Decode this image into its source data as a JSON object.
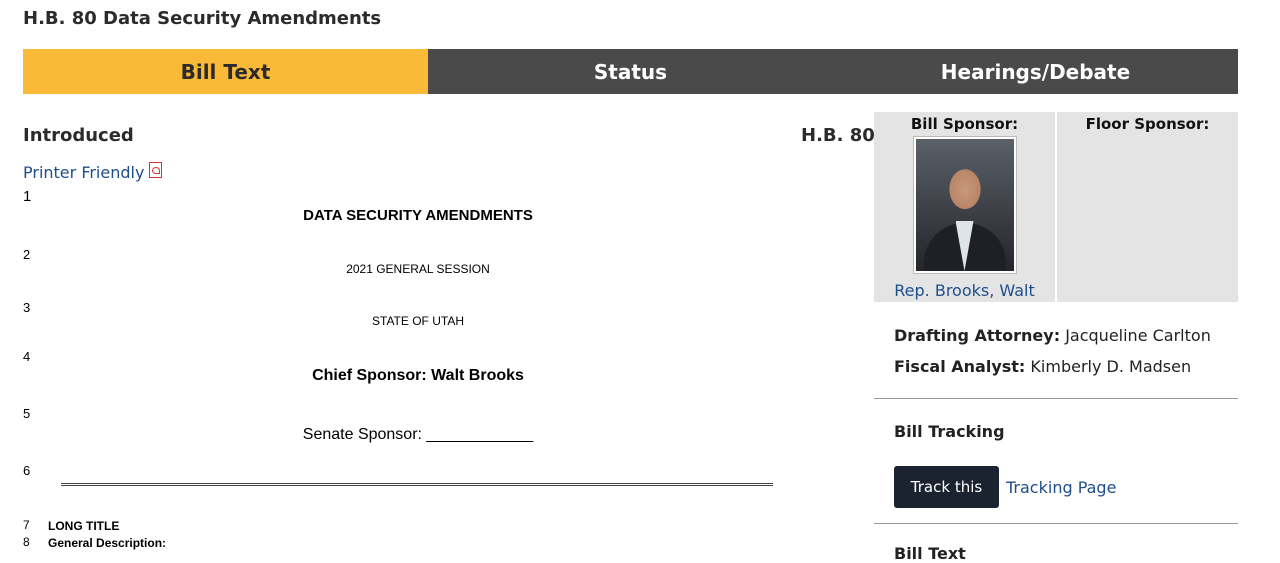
{
  "page": {
    "title": "H.B. 80 Data Security Amendments"
  },
  "tabs": [
    {
      "label": "Bill Text",
      "active": true
    },
    {
      "label": "Status",
      "active": false
    },
    {
      "label": "Hearings/Debate",
      "active": false
    }
  ],
  "main": {
    "heading": "Introduced",
    "bill_number": "H.B. 80",
    "printer_link": "Printer Friendly",
    "printer_icon": "pdf-icon"
  },
  "document": {
    "line_numbers": [
      "1",
      "2",
      "3",
      "4",
      "5",
      "6",
      "7",
      "8"
    ],
    "title": "DATA SECURITY AMENDMENTS",
    "session": "2021 GENERAL SESSION",
    "state": "STATE OF UTAH",
    "chief_sponsor": "Chief Sponsor: Walt Brooks",
    "senate_sponsor": "Senate Sponsor: ____________",
    "long_title": "LONG TITLE",
    "general_description": "General Description:"
  },
  "sidebar": {
    "bill_sponsor_label": "Bill Sponsor:",
    "floor_sponsor_label": "Floor Sponsor:",
    "sponsor_name": "Rep. Brooks, Walt",
    "drafting_attorney_label": "Drafting Attorney:",
    "drafting_attorney": "Jacqueline Carlton",
    "fiscal_analyst_label": "Fiscal Analyst:",
    "fiscal_analyst": "Kimberly D. Madsen",
    "tracking_title": "Bill Tracking",
    "track_button": "Track this",
    "tracking_page_link": "Tracking Page",
    "next_heading": "Bill Text"
  },
  "colors": {
    "active_tab": "#fbb938",
    "tab_bar": "#4a4a4a",
    "link": "#1f4e8c",
    "button": "#1b2330"
  }
}
